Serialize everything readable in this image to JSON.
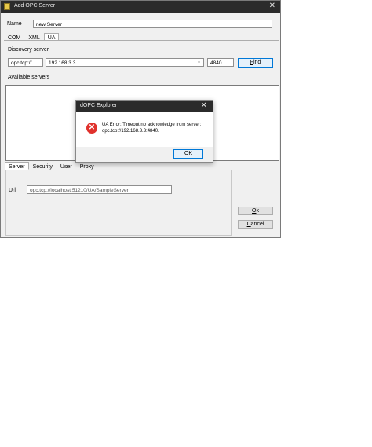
{
  "window": {
    "title": "Add OPC Server"
  },
  "name_field": {
    "label": "Name",
    "value": "new Server"
  },
  "top_tabs": [
    "COM",
    "XML",
    "UA"
  ],
  "discovery": {
    "label": "Discovery server",
    "protocol": "opc.tcp://",
    "host": "192.168.3.3",
    "port": "4840",
    "find_button": "Find"
  },
  "available_servers": {
    "label": "Available servers"
  },
  "bottom_tabs": [
    "Server",
    "Security",
    "User",
    "Proxy"
  ],
  "url_field": {
    "label": "Url",
    "value": "opc.tcp://localhost:51210/UA/SampleServer"
  },
  "buttons": {
    "ok": "Ok",
    "cancel": "Cancel"
  },
  "dialog": {
    "title": "dOPC Explorer",
    "message_line1": "UA Error: Timeout no acknowledge from server:",
    "message_line2": "opc.tcp://192.168.3.3:4840.",
    "ok_button": "OK"
  },
  "colors": {
    "titlebar": "#2b2b2b",
    "error": "#e0312c",
    "accent": "#0078d7"
  }
}
